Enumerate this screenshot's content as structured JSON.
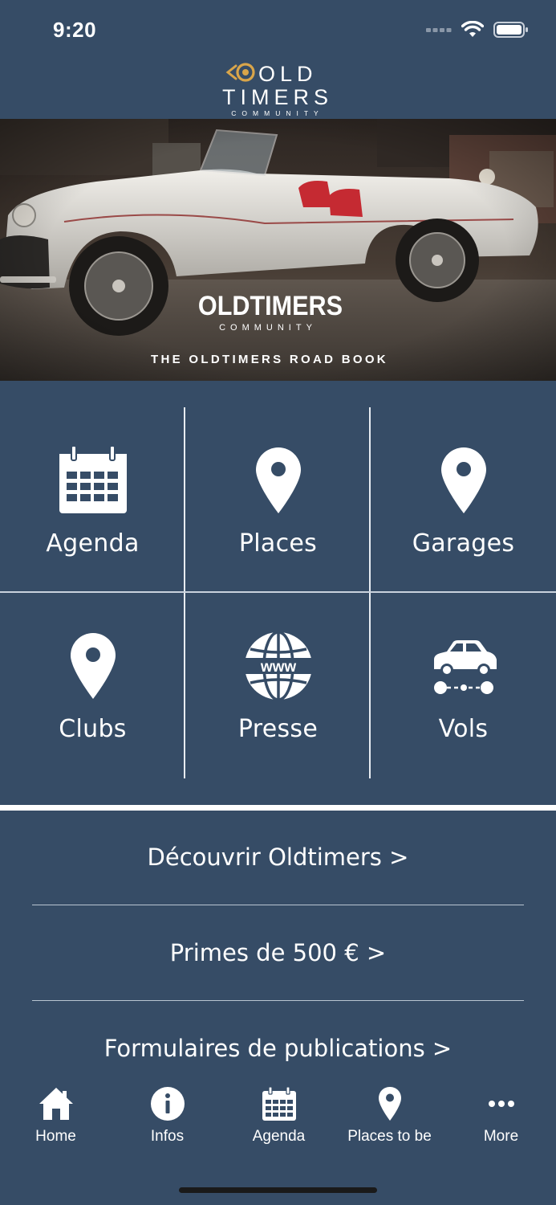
{
  "status": {
    "time": "9:20"
  },
  "logo": {
    "line1": "OLD",
    "line2": "TIMERS",
    "line3": "COMMUNITY"
  },
  "hero": {
    "brand": "OLDTIMERS",
    "brand_sub": "COMMUNITY",
    "tagline": "THE OLDTIMERS ROAD BOOK"
  },
  "grid": {
    "items": [
      {
        "label": "Agenda",
        "icon": "calendar-icon"
      },
      {
        "label": "Places",
        "icon": "map-pin-icon"
      },
      {
        "label": "Garages",
        "icon": "map-pin-icon"
      },
      {
        "label": "Clubs",
        "icon": "map-pin-icon"
      },
      {
        "label": "Presse",
        "icon": "globe-www-icon"
      },
      {
        "label": "Vols",
        "icon": "car-icon"
      }
    ]
  },
  "links": [
    "Découvrir Oldtimers >",
    "Primes de 500 € >",
    "Formulaires de publications >"
  ],
  "tabbar": {
    "items": [
      {
        "label": "Home",
        "icon": "home-icon"
      },
      {
        "label": "Infos",
        "icon": "info-icon"
      },
      {
        "label": "Agenda",
        "icon": "calendar-icon"
      },
      {
        "label": "Places to be",
        "icon": "map-pin-icon"
      },
      {
        "label": "More",
        "icon": "more-icon"
      }
    ]
  },
  "colors": {
    "background": "#364c66",
    "accent": "#d9a54a",
    "text": "#ffffff"
  }
}
